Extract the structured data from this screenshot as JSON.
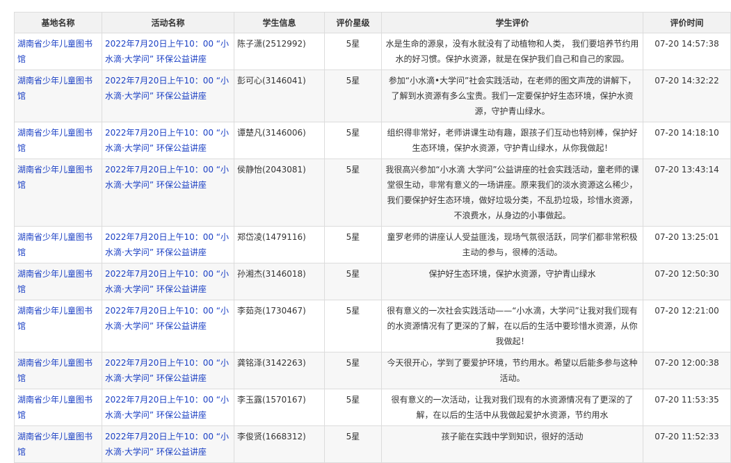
{
  "table": {
    "headers": [
      "基地名称",
      "活动名称",
      "学生信息",
      "评价星级",
      "学生评价",
      "评价时间"
    ],
    "rows": [
      {
        "base": "湖南省少年儿童图书馆",
        "activity": "2022年7月20日上午10：00 “小水滴·大学问” 环保公益讲座",
        "student": "陈子潇(2512992)",
        "rating": "5星",
        "comment": "水是生命的源泉，没有水就没有了动植物和人类， 我们要培养节约用水的好习惯。保护水资源，就是在保护我们自己和自己的家园。",
        "time": "07-20 14:57:38"
      },
      {
        "base": "湖南省少年儿童图书馆",
        "activity": "2022年7月20日上午10：00 “小水滴·大学问” 环保公益讲座",
        "student": "彭可心(3146041)",
        "rating": "5星",
        "comment": "参加“小水滴•大学问”社会实践活动，在老师的图文声茂的讲解下，了解到水资源有多么宝贵。我们一定要保护好生态环境，保护水资源，守护青山绿水。",
        "time": "07-20 14:32:22"
      },
      {
        "base": "湖南省少年儿童图书馆",
        "activity": "2022年7月20日上午10：00 “小水滴·大学问” 环保公益讲座",
        "student": "谭楚凡(3146006)",
        "rating": "5星",
        "comment": "组织得非常好，老师讲课生动有趣，跟孩子们互动也特别棒，保护好生态环境，保护水资源，守护青山绿水，从你我做起！",
        "time": "07-20 14:18:10"
      },
      {
        "base": "湖南省少年儿童图书馆",
        "activity": "2022年7月20日上午10：00 “小水滴·大学问” 环保公益讲座",
        "student": "侯静怡(2043081)",
        "rating": "5星",
        "comment": "我很高兴参加“小水滴 大学问”公益讲座的社会实践活动，童老师的课堂很生动，非常有意义的一场讲座。原来我们的淡水资源这么稀少，我们要保护好生态环境，做好垃圾分类，不乱扔垃圾，珍惜水资源，不浪费水，从身边的小事做起。",
        "time": "07-20 13:43:14"
      },
      {
        "base": "湖南省少年儿童图书馆",
        "activity": "2022年7月20日上午10：00 “小水滴·大学问” 环保公益讲座",
        "student": "郑岱凌(1479116)",
        "rating": "5星",
        "comment": "童罗老师的讲座认人受益匪浅，现场气氛很活跃，同学们都非常积极主动的参与，很棒的活动。",
        "time": "07-20 13:25:01"
      },
      {
        "base": "湖南省少年儿童图书馆",
        "activity": "2022年7月20日上午10：00 “小水滴·大学问” 环保公益讲座",
        "student": "孙湘杰(3146018)",
        "rating": "5星",
        "comment": "保护好生态环境，保护水资源，守护青山绿水",
        "time": "07-20 12:50:30"
      },
      {
        "base": "湖南省少年儿童图书馆",
        "activity": "2022年7月20日上午10：00 “小水滴·大学问” 环保公益讲座",
        "student": "李茹尧(1730467)",
        "rating": "5星",
        "comment": "很有意义的一次社会实践活动——“小水滴，大学问”让我对我们现有的水资源情况有了更深的了解，在以后的生活中要珍惜水资源，从你我做起！",
        "time": "07-20 12:21:00"
      },
      {
        "base": "湖南省少年儿童图书馆",
        "activity": "2022年7月20日上午10：00 “小水滴·大学问” 环保公益讲座",
        "student": "龚铭泽(3142263)",
        "rating": "5星",
        "comment": "今天很开心，学到了要爱护环境，节约用水。希望以后能多参与这种活动。",
        "time": "07-20 12:00:38"
      },
      {
        "base": "湖南省少年儿童图书馆",
        "activity": "2022年7月20日上午10：00 “小水滴·大学问” 环保公益讲座",
        "student": "李玉露(1570167)",
        "rating": "5星",
        "comment": "很有意义的一次活动，让我对我们现有的水资源情况有了更深的了解，在以后的生活中从我做起爱护水资源，节约用水",
        "time": "07-20 11:53:35"
      },
      {
        "base": "湖南省少年儿童图书馆",
        "activity": "2022年7月20日上午10：00 “小水滴·大学问” 环保公益讲座",
        "student": "李俊贤(1668312)",
        "rating": "5星",
        "comment": "孩子能在实践中学到知识，很好的活动",
        "time": "07-20 11:52:33"
      }
    ]
  }
}
